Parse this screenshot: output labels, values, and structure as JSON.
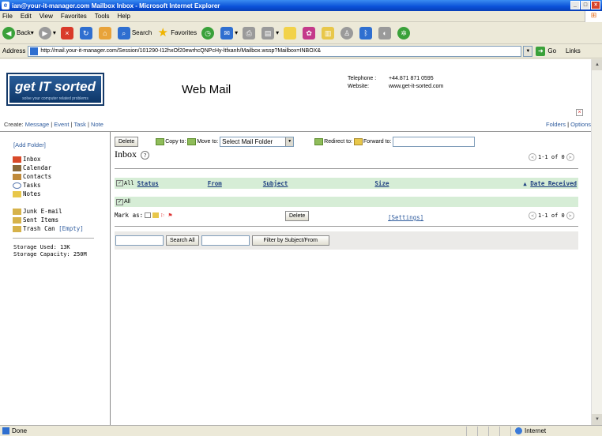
{
  "window": {
    "title": "ian@your-it-manager.com Mailbox Inbox - Microsoft Internet Explorer",
    "minimize": "_",
    "maximize": "□",
    "close": "×"
  },
  "menu": [
    "File",
    "Edit",
    "View",
    "Favorites",
    "Tools",
    "Help"
  ],
  "toolbar": {
    "back": "Back",
    "search": "Search",
    "favorites": "Favorites"
  },
  "address": {
    "label": "Address",
    "url": "http://mail.your-it-manager.com/Session/101290-I12hxOf20ewrhcQNPcHy-ltfxanh/Mailbox.wssp?Mailbox=INBOX&",
    "go": "Go",
    "links": "Links"
  },
  "header": {
    "logo_brand": "get IT sorted",
    "logo_tag": "solve your computer related problems",
    "app_name": "Web Mail",
    "telephone_label": "Telephone :",
    "telephone": "+44.871 871 0595",
    "website_label": "Website:",
    "website": "www.get-it-sorted.com",
    "create_label": "Create:",
    "create_links": [
      "Message",
      "Event",
      "Task",
      "Note"
    ],
    "folders_link": "Folders",
    "options_link": "Options",
    "divider": "|"
  },
  "sidebar": {
    "add_folder": "[Add Folder]",
    "folders": [
      {
        "label": "Inbox",
        "color": "#d94a2a"
      },
      {
        "label": "Calendar",
        "color": "#8a6a3a"
      },
      {
        "label": "Contacts",
        "color": "#c08a3a"
      },
      {
        "label": "Tasks",
        "color": "#5a7ab0"
      },
      {
        "label": "Notes",
        "color": "#e8c74a"
      },
      {
        "label": "Junk E-mail",
        "color": "#d6b24a"
      },
      {
        "label": "Sent Items",
        "color": "#d6b24a"
      },
      {
        "label": "Trash Can",
        "color": "#d6b24a"
      }
    ],
    "empty_link": "[Empty]",
    "storage_used": "Storage Used: 13K",
    "storage_capacity": "Storage Capacity: 250M"
  },
  "actions": {
    "delete": "Delete",
    "copy_to": "Copy to:",
    "move_to": "Move to:",
    "folder_select": "Select Mail Folder",
    "redirect_to": "Redirect to:",
    "forward_to": "Forward to:"
  },
  "mailbox": {
    "title": "Inbox",
    "help": "?",
    "pager_text": "1-1 of 0",
    "columns": [
      "Status",
      "From",
      "Subject",
      "Size",
      "Date Received"
    ],
    "all_label": "All",
    "mark_as": "Mark as:",
    "delete": "Delete",
    "settings": "[Settings]"
  },
  "search": {
    "search_all": "Search All",
    "filter": "Filter by Subject/From"
  },
  "status": {
    "text": "Done",
    "zone": "Internet"
  }
}
